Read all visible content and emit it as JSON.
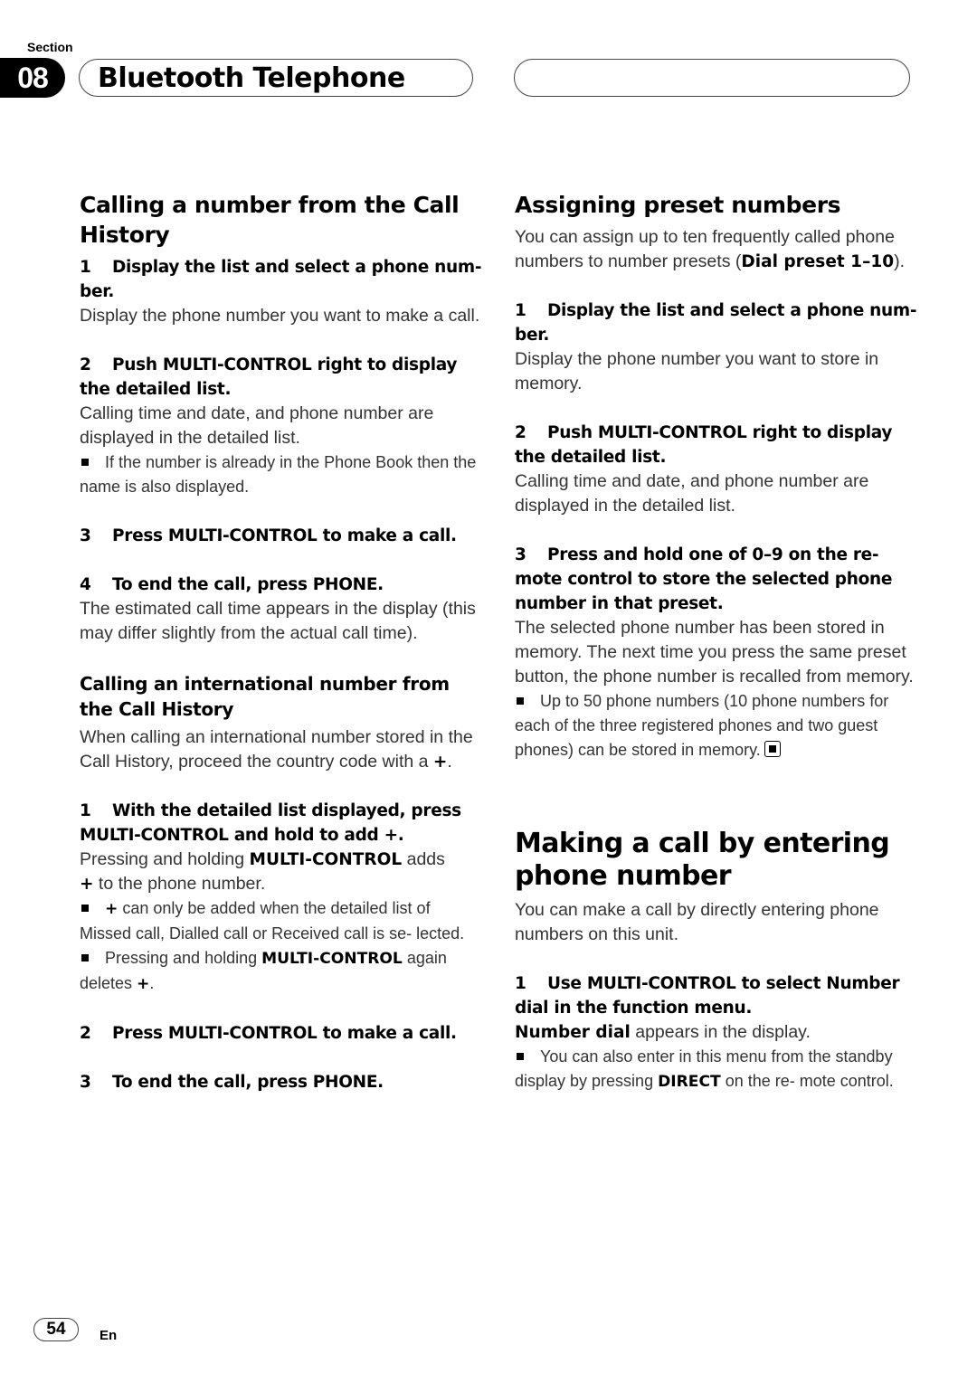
{
  "header": {
    "section_label": "Section",
    "section_number": "08",
    "title": "Bluetooth Telephone"
  },
  "left": {
    "heading": "Calling a number from the Call History",
    "steps": [
      {
        "num": "1",
        "title": "Display the list and select a phone num- ber.",
        "body": "Display the phone number you want to make a call."
      },
      {
        "num": "2",
        "title": "Push MULTI-CONTROL right to display the detailed list.",
        "body": "Calling time and date, and phone number are displayed in the detailed list.",
        "note": "If the number is already in the Phone Book then the name is also displayed."
      },
      {
        "num": "3",
        "title": "Press MULTI-CONTROL to make a call."
      },
      {
        "num": "4",
        "title": "To end the call, press PHONE.",
        "body": "The estimated call time appears in the display (this may differ slightly from the actual call time)."
      }
    ],
    "subheading": "Calling an international number from the Call History",
    "sub_intro_pre": "When calling an international number stored in the Call History, proceed the country code with a ",
    "sub_intro_bold": "+",
    "sub_intro_post": ".",
    "sub_steps": [
      {
        "num": "1",
        "title": "With the detailed list displayed, press MULTI-CONTROL and hold to add +.",
        "body_pre": "Pressing and holding ",
        "body_bold": "MULTI-CONTROL",
        "body_mid": " adds ",
        "body_bold2": "+",
        "body_post": " to the phone number.",
        "note1_bold": "+",
        "note1_text": " can only be added when the detailed list of Missed call, Dialled call or Received call is se- lected.",
        "note2_pre": "Pressing and holding ",
        "note2_bold": "MULTI-CONTROL",
        "note2_mid": " again deletes ",
        "note2_bold2": "+",
        "note2_post": "."
      },
      {
        "num": "2",
        "title": "Press MULTI-CONTROL to make a call."
      },
      {
        "num": "3",
        "title": "To end the call, press PHONE."
      }
    ]
  },
  "right": {
    "heading": "Assigning preset numbers",
    "intro_pre": "You can assign up to ten frequently called phone numbers to number presets (",
    "intro_bold": "Dial preset 1–10",
    "intro_post": ").",
    "steps": [
      {
        "num": "1",
        "title": "Display the list and select a phone num- ber.",
        "body": "Display the phone number you want to store in memory."
      },
      {
        "num": "2",
        "title": "Push MULTI-CONTROL right to display the detailed list.",
        "body": "Calling time and date, and phone number are displayed in the detailed list."
      },
      {
        "num": "3",
        "title": "Press and hold one of 0–9 on the re- mote control to store the selected phone number in that preset.",
        "body": "The selected phone number has been stored in memory. The next time you press the same preset button, the phone number is recalled from memory.",
        "note": "Up to 50 phone numbers (10 phone numbers for each of the three registered phones and two guest phones) can be stored in memory."
      }
    ],
    "heading2": "Making a call by entering phone number",
    "intro2": "You can make a call by directly entering phone numbers on this unit.",
    "steps2": [
      {
        "num": "1",
        "title": "Use MULTI-CONTROL to select Number dial in the function menu.",
        "body_bold": "Number dial",
        "body_post": " appears in the display.",
        "note_pre": "You can also enter in this menu from the standby display by pressing ",
        "note_bold": "DIRECT",
        "note_post": " on the re- mote control."
      }
    ]
  },
  "footer": {
    "page_number": "54",
    "language": "En"
  }
}
